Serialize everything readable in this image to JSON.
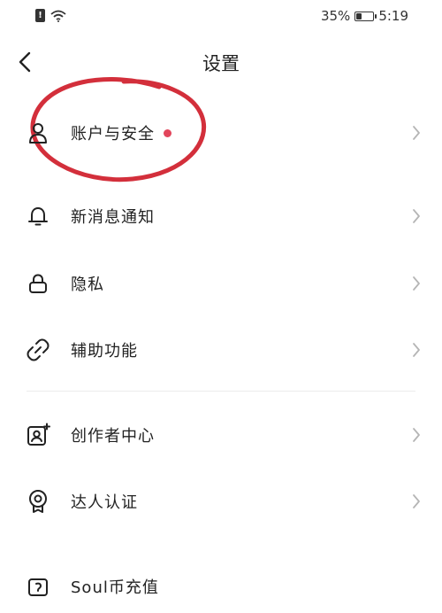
{
  "status_bar": {
    "battery_text": "35%",
    "battery_level": 0.35,
    "time": "5:19"
  },
  "header": {
    "title": "设置"
  },
  "settings": {
    "items": [
      {
        "label": "账户与安全",
        "icon": "user-icon",
        "has_badge": true
      },
      {
        "label": "新消息通知",
        "icon": "bell-icon",
        "has_badge": false
      },
      {
        "label": "隐私",
        "icon": "lock-icon",
        "has_badge": false
      },
      {
        "label": "辅助功能",
        "icon": "link-icon",
        "has_badge": false
      },
      {
        "label": "创作者中心",
        "icon": "creator-icon",
        "has_badge": false
      },
      {
        "label": "达人认证",
        "icon": "badge-icon",
        "has_badge": false
      },
      {
        "label": "Soul币充值",
        "icon": "wallet-icon",
        "has_badge": false
      }
    ]
  },
  "colors": {
    "badge": "#e2455b",
    "annotation": "#d32f3b",
    "chevron": "#b5b5b5",
    "text": "#222222"
  }
}
